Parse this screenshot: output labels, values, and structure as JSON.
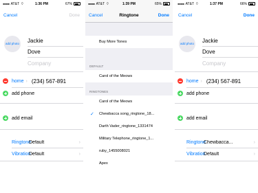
{
  "screens": [
    {
      "status": {
        "carrier": "AT&T",
        "time": "1:36 PM",
        "battery": "67%",
        "battery_level": 0.67
      },
      "nav": {
        "left": "Cancel",
        "right": "Done"
      },
      "photo_label": "add photo",
      "first_name": "Jackie",
      "last_name": "Dove",
      "company_placeholder": "Company",
      "phone_label": "home",
      "phone_number": "(234) 567-891",
      "add_phone": "add phone",
      "add_email": "add email",
      "ringtone_label": "Ringtone",
      "ringtone_value": "Default",
      "vibration_label": "Vibration",
      "vibration_value": "Default"
    },
    {
      "status": {
        "carrier": "AT&T",
        "time": "1:39 PM",
        "battery": "65%",
        "battery_level": 0.65
      },
      "nav": {
        "left": "Cancel",
        "title": "Ringtone",
        "right": "Done"
      },
      "buy_more": "Buy More Tones",
      "default_header": "DEFAULT",
      "default_item": "Carol of the Meows",
      "ringtones_header": "RINGTONES",
      "ringtones": [
        {
          "label": "Carol of the Meows",
          "checked": false
        },
        {
          "label": "Chewbacca song_ringtone_18...",
          "checked": true
        },
        {
          "label": "Darth Vader_ringtone_1331474",
          "checked": false
        },
        {
          "label": "Military Telephone_ringtone_1...",
          "checked": false
        },
        {
          "label": "ruby_1455008021",
          "checked": false
        },
        {
          "label": "Apex",
          "checked": false
        }
      ]
    },
    {
      "status": {
        "carrier": "AT&T",
        "time": "1:37 PM",
        "battery": "66%",
        "battery_level": 0.66
      },
      "nav": {
        "left": "Cancel",
        "right": "Done"
      },
      "photo_label": "add photo",
      "first_name": "Jackie",
      "last_name": "Dove",
      "company_placeholder": "Company",
      "phone_label": "home",
      "phone_number": "(234) 567-891",
      "add_phone": "add phone",
      "add_email": "add email",
      "ringtone_label": "Ringtone",
      "ringtone_value": "Chewbacca...",
      "vibration_label": "Vibration",
      "vibration_value": "Default"
    }
  ],
  "colors": {
    "accent": "#007aff",
    "delete": "#ff3b30",
    "add": "#4cd964",
    "placeholder": "#c7c7cc"
  }
}
